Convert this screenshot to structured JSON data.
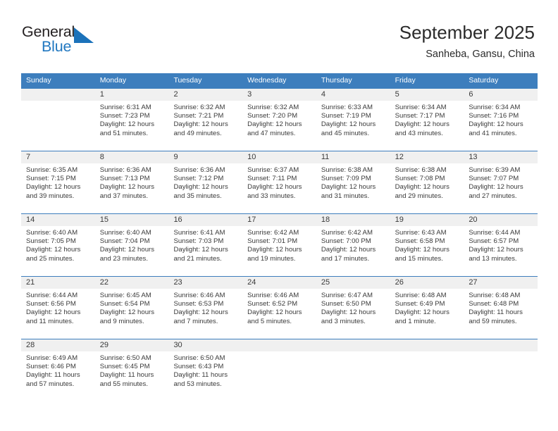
{
  "brand": {
    "name_part1": "General",
    "name_part2": "Blue",
    "flag_icon": "triangle-flag-icon",
    "accent_color": "#1b72ba"
  },
  "header": {
    "title": "September 2025",
    "location": "Sanheba, Gansu, China"
  },
  "calendar": {
    "header_bg": "#3d7ebd",
    "daynum_bg": "#f0f0f0",
    "day_names": [
      "Sunday",
      "Monday",
      "Tuesday",
      "Wednesday",
      "Thursday",
      "Friday",
      "Saturday"
    ],
    "weeks": [
      [
        {
          "day": "",
          "sunrise": "",
          "sunset": "",
          "daylight": "",
          "daylight2": ""
        },
        {
          "day": "1",
          "sunrise": "Sunrise: 6:31 AM",
          "sunset": "Sunset: 7:23 PM",
          "daylight": "Daylight: 12 hours",
          "daylight2": "and 51 minutes."
        },
        {
          "day": "2",
          "sunrise": "Sunrise: 6:32 AM",
          "sunset": "Sunset: 7:21 PM",
          "daylight": "Daylight: 12 hours",
          "daylight2": "and 49 minutes."
        },
        {
          "day": "3",
          "sunrise": "Sunrise: 6:32 AM",
          "sunset": "Sunset: 7:20 PM",
          "daylight": "Daylight: 12 hours",
          "daylight2": "and 47 minutes."
        },
        {
          "day": "4",
          "sunrise": "Sunrise: 6:33 AM",
          "sunset": "Sunset: 7:19 PM",
          "daylight": "Daylight: 12 hours",
          "daylight2": "and 45 minutes."
        },
        {
          "day": "5",
          "sunrise": "Sunrise: 6:34 AM",
          "sunset": "Sunset: 7:17 PM",
          "daylight": "Daylight: 12 hours",
          "daylight2": "and 43 minutes."
        },
        {
          "day": "6",
          "sunrise": "Sunrise: 6:34 AM",
          "sunset": "Sunset: 7:16 PM",
          "daylight": "Daylight: 12 hours",
          "daylight2": "and 41 minutes."
        }
      ],
      [
        {
          "day": "7",
          "sunrise": "Sunrise: 6:35 AM",
          "sunset": "Sunset: 7:15 PM",
          "daylight": "Daylight: 12 hours",
          "daylight2": "and 39 minutes."
        },
        {
          "day": "8",
          "sunrise": "Sunrise: 6:36 AM",
          "sunset": "Sunset: 7:13 PM",
          "daylight": "Daylight: 12 hours",
          "daylight2": "and 37 minutes."
        },
        {
          "day": "9",
          "sunrise": "Sunrise: 6:36 AM",
          "sunset": "Sunset: 7:12 PM",
          "daylight": "Daylight: 12 hours",
          "daylight2": "and 35 minutes."
        },
        {
          "day": "10",
          "sunrise": "Sunrise: 6:37 AM",
          "sunset": "Sunset: 7:11 PM",
          "daylight": "Daylight: 12 hours",
          "daylight2": "and 33 minutes."
        },
        {
          "day": "11",
          "sunrise": "Sunrise: 6:38 AM",
          "sunset": "Sunset: 7:09 PM",
          "daylight": "Daylight: 12 hours",
          "daylight2": "and 31 minutes."
        },
        {
          "day": "12",
          "sunrise": "Sunrise: 6:38 AM",
          "sunset": "Sunset: 7:08 PM",
          "daylight": "Daylight: 12 hours",
          "daylight2": "and 29 minutes."
        },
        {
          "day": "13",
          "sunrise": "Sunrise: 6:39 AM",
          "sunset": "Sunset: 7:07 PM",
          "daylight": "Daylight: 12 hours",
          "daylight2": "and 27 minutes."
        }
      ],
      [
        {
          "day": "14",
          "sunrise": "Sunrise: 6:40 AM",
          "sunset": "Sunset: 7:05 PM",
          "daylight": "Daylight: 12 hours",
          "daylight2": "and 25 minutes."
        },
        {
          "day": "15",
          "sunrise": "Sunrise: 6:40 AM",
          "sunset": "Sunset: 7:04 PM",
          "daylight": "Daylight: 12 hours",
          "daylight2": "and 23 minutes."
        },
        {
          "day": "16",
          "sunrise": "Sunrise: 6:41 AM",
          "sunset": "Sunset: 7:03 PM",
          "daylight": "Daylight: 12 hours",
          "daylight2": "and 21 minutes."
        },
        {
          "day": "17",
          "sunrise": "Sunrise: 6:42 AM",
          "sunset": "Sunset: 7:01 PM",
          "daylight": "Daylight: 12 hours",
          "daylight2": "and 19 minutes."
        },
        {
          "day": "18",
          "sunrise": "Sunrise: 6:42 AM",
          "sunset": "Sunset: 7:00 PM",
          "daylight": "Daylight: 12 hours",
          "daylight2": "and 17 minutes."
        },
        {
          "day": "19",
          "sunrise": "Sunrise: 6:43 AM",
          "sunset": "Sunset: 6:58 PM",
          "daylight": "Daylight: 12 hours",
          "daylight2": "and 15 minutes."
        },
        {
          "day": "20",
          "sunrise": "Sunrise: 6:44 AM",
          "sunset": "Sunset: 6:57 PM",
          "daylight": "Daylight: 12 hours",
          "daylight2": "and 13 minutes."
        }
      ],
      [
        {
          "day": "21",
          "sunrise": "Sunrise: 6:44 AM",
          "sunset": "Sunset: 6:56 PM",
          "daylight": "Daylight: 12 hours",
          "daylight2": "and 11 minutes."
        },
        {
          "day": "22",
          "sunrise": "Sunrise: 6:45 AM",
          "sunset": "Sunset: 6:54 PM",
          "daylight": "Daylight: 12 hours",
          "daylight2": "and 9 minutes."
        },
        {
          "day": "23",
          "sunrise": "Sunrise: 6:46 AM",
          "sunset": "Sunset: 6:53 PM",
          "daylight": "Daylight: 12 hours",
          "daylight2": "and 7 minutes."
        },
        {
          "day": "24",
          "sunrise": "Sunrise: 6:46 AM",
          "sunset": "Sunset: 6:52 PM",
          "daylight": "Daylight: 12 hours",
          "daylight2": "and 5 minutes."
        },
        {
          "day": "25",
          "sunrise": "Sunrise: 6:47 AM",
          "sunset": "Sunset: 6:50 PM",
          "daylight": "Daylight: 12 hours",
          "daylight2": "and 3 minutes."
        },
        {
          "day": "26",
          "sunrise": "Sunrise: 6:48 AM",
          "sunset": "Sunset: 6:49 PM",
          "daylight": "Daylight: 12 hours",
          "daylight2": "and 1 minute."
        },
        {
          "day": "27",
          "sunrise": "Sunrise: 6:48 AM",
          "sunset": "Sunset: 6:48 PM",
          "daylight": "Daylight: 11 hours",
          "daylight2": "and 59 minutes."
        }
      ],
      [
        {
          "day": "28",
          "sunrise": "Sunrise: 6:49 AM",
          "sunset": "Sunset: 6:46 PM",
          "daylight": "Daylight: 11 hours",
          "daylight2": "and 57 minutes."
        },
        {
          "day": "29",
          "sunrise": "Sunrise: 6:50 AM",
          "sunset": "Sunset: 6:45 PM",
          "daylight": "Daylight: 11 hours",
          "daylight2": "and 55 minutes."
        },
        {
          "day": "30",
          "sunrise": "Sunrise: 6:50 AM",
          "sunset": "Sunset: 6:43 PM",
          "daylight": "Daylight: 11 hours",
          "daylight2": "and 53 minutes."
        },
        {
          "day": "",
          "sunrise": "",
          "sunset": "",
          "daylight": "",
          "daylight2": ""
        },
        {
          "day": "",
          "sunrise": "",
          "sunset": "",
          "daylight": "",
          "daylight2": ""
        },
        {
          "day": "",
          "sunrise": "",
          "sunset": "",
          "daylight": "",
          "daylight2": ""
        },
        {
          "day": "",
          "sunrise": "",
          "sunset": "",
          "daylight": "",
          "daylight2": ""
        }
      ]
    ]
  }
}
